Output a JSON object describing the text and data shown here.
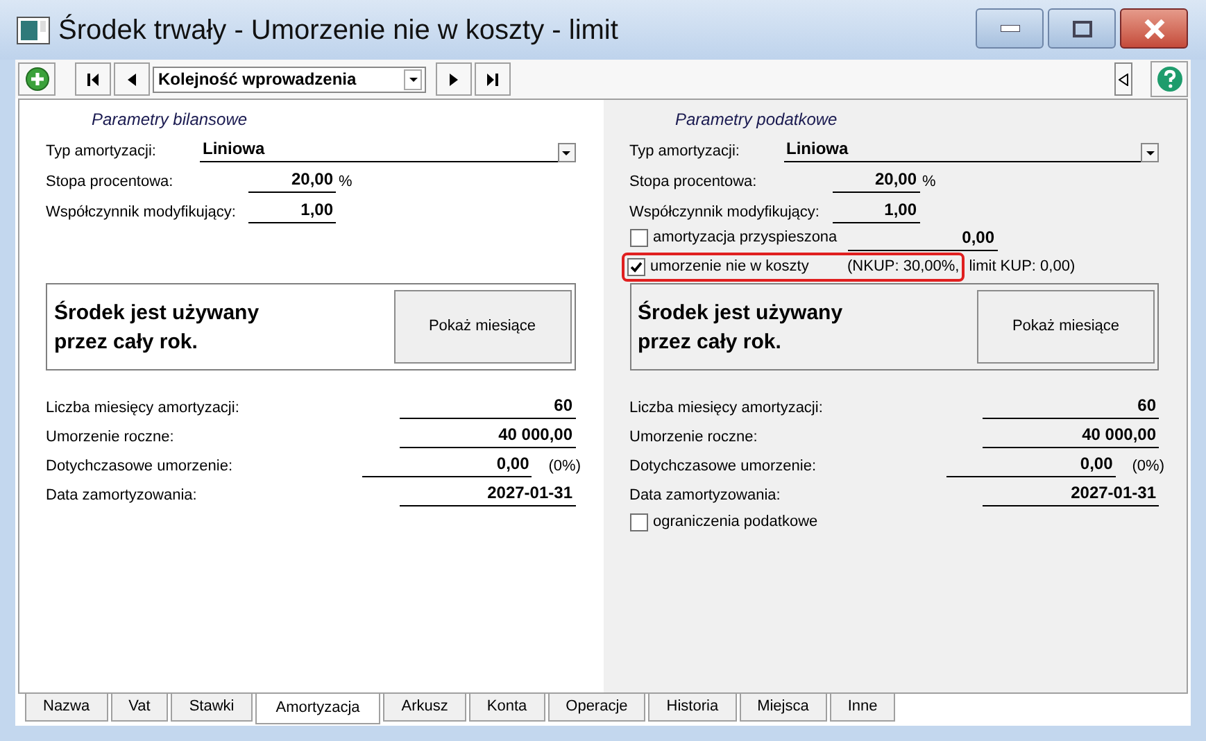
{
  "window": {
    "title": "Środek trwały - Umorzenie nie w koszty - limit"
  },
  "toolbar": {
    "sort_order": "Kolejność wprowadzenia"
  },
  "left_panel": {
    "heading": "Parametry bilansowe",
    "fields": [
      {
        "kind": "dropdown",
        "label": "Typ amortyzacji:",
        "value": "Liniowa"
      },
      {
        "kind": "number",
        "label": "Stopa procentowa:",
        "value": "20,00",
        "unit": "%"
      },
      {
        "kind": "number",
        "label": "Współczynnik modyfikujący:",
        "value": "1,00"
      }
    ],
    "usage_note": [
      "Środek jest używany",
      "przez cały rok."
    ],
    "button": "Pokaż miesiące",
    "summary": [
      {
        "kind": "short",
        "label": "Liczba miesięcy amortyzacji:",
        "value": "60"
      },
      {
        "kind": "short",
        "label": "Umorzenie roczne:",
        "value": "40 000,00"
      },
      {
        "kind": "long",
        "label": "Dotychczasowe umorzenie:",
        "value": "0,00",
        "note": "(0%)"
      },
      {
        "kind": "short",
        "label": "Data zamortyzowania:",
        "value": "2027-01-31"
      }
    ]
  },
  "right_panel": {
    "heading": "Parametry podatkowe",
    "fields": [
      {
        "kind": "dropdown",
        "label": "Typ amortyzacji:",
        "value": "Liniowa"
      },
      {
        "kind": "number",
        "label": "Stopa procentowa:",
        "value": "20,00",
        "unit": "%"
      },
      {
        "kind": "number",
        "label": "Współczynnik modyfikujący:",
        "value": "1,00"
      }
    ],
    "options": [
      {
        "label": "amortyzacja przyspieszona",
        "checked": false,
        "highlighted": false,
        "value": "0,00"
      },
      {
        "label": "umorzenie nie w koszty",
        "checked": true,
        "highlighted": true,
        "note": "(NKUP: 30,00%,",
        "note_2": "limit KUP: 0,00)"
      }
    ],
    "usage_note": [
      "Środek jest używany",
      "przez cały rok."
    ],
    "button": "Pokaż miesiące",
    "summary": [
      {
        "kind": "short",
        "label": "Liczba miesięcy amortyzacji:",
        "value": "60"
      },
      {
        "kind": "short",
        "label": "Umorzenie roczne:",
        "value": "40 000,00"
      },
      {
        "kind": "long",
        "label": "Dotychczasowe umorzenie:",
        "value": "0,00",
        "note": "(0%)"
      },
      {
        "kind": "short",
        "label": "Data zamortyzowania:",
        "value": "2027-01-31"
      }
    ],
    "restriction": {
      "label": "ograniczenia podatkowe",
      "checked": false
    }
  },
  "tabs": [
    {
      "label": "Nazwa",
      "selected": false
    },
    {
      "label": "Vat",
      "selected": false
    },
    {
      "label": "Stawki",
      "selected": false
    },
    {
      "label": "Amortyzacja",
      "selected": true
    },
    {
      "label": "Arkusz",
      "selected": false
    },
    {
      "label": "Konta",
      "selected": false
    },
    {
      "label": "Operacje",
      "selected": false
    },
    {
      "label": "Historia",
      "selected": false
    },
    {
      "label": "Miejsca",
      "selected": false
    },
    {
      "label": "Inne",
      "selected": false
    }
  ]
}
